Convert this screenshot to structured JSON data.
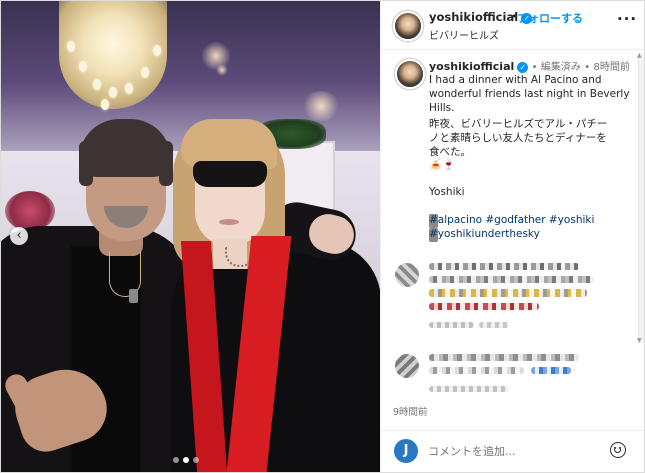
{
  "post": {
    "username": "yoshikiofficial",
    "verified_mark": "✓",
    "separator": "•",
    "follow_label": "フォローする",
    "location": "ビバリーヒルズ",
    "more_label": "···"
  },
  "caption": {
    "username": "yoshikiofficial",
    "edited_label": "編集済み",
    "time_label": "8時間前",
    "lines": [
      "I had a dinner with Al Pacino and",
      "wonderful friends last night in Beverly",
      "Hills.",
      "昨夜、ビバリーヒルズでアル・パチー",
      "ノと素晴らしい友人たちとディナーを",
      "食べた。",
      "🍝🍷",
      "Yoshiki"
    ],
    "hashtags": [
      "#alpacino #godfather #yoshiki",
      "#yoshikiunderthesky"
    ]
  },
  "photo": {
    "nav_prev_label": "‹",
    "carousel_dots": 3,
    "active_dot": 1
  },
  "footer": {
    "timestamp": "9時間前",
    "comment_avatar_letter": "J",
    "comment_placeholder": "コメントを追加...",
    "emoji_icon": "smiley-face-icon"
  },
  "colors": {
    "accent": "#0095f6",
    "hashtag": "#00376b",
    "muted": "#737373",
    "scarf": "#d81d22"
  }
}
